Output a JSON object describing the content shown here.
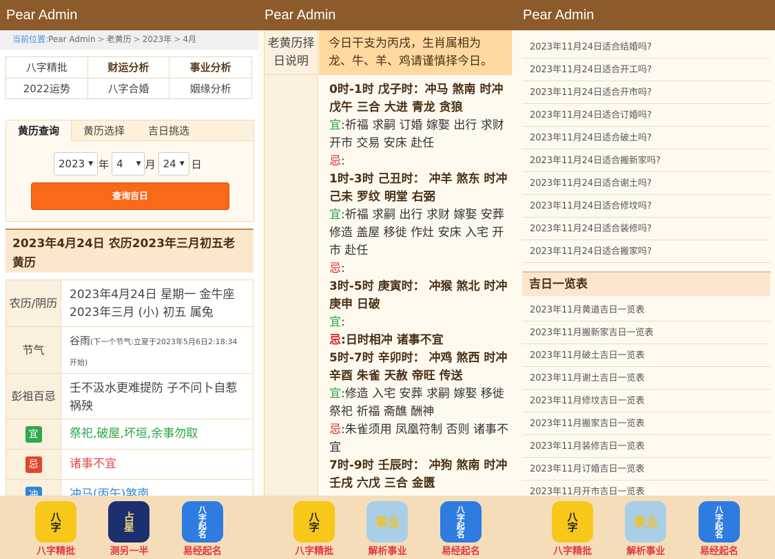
{
  "app_title": "Pear Admin",
  "breadcrumb": [
    "当前位置:",
    "Pear Admin",
    "老黄历",
    "2023年",
    "4月"
  ],
  "nav_grid": [
    "八字精批",
    "财运分析",
    "事业分析",
    "2022运势",
    "八字合婚",
    "姻缘分析"
  ],
  "query": {
    "tabs": [
      "黄历查询",
      "黄历选择",
      "吉日挑选"
    ],
    "year": "2023",
    "year_unit": "年",
    "month": "4",
    "month_unit": "月",
    "day": "24",
    "day_unit": "日",
    "button": "查询吉日"
  },
  "day_title": "2023年4月24日 农历2023年三月初五老黄历",
  "details": {
    "nongli_label": "农历/阴历",
    "nongli_line1": "2023年4月24日 星期一 金牛座",
    "nongli_line2": "2023年三月 (小) 初五 属兔",
    "jieqi_label": "节气",
    "jieqi_value": "谷雨",
    "jieqi_note": "(下一个节气:立夏于2023年5月6日2:18:34开始)",
    "pengzu_label": "彭祖百忌",
    "pengzu_value": "壬不汲水更难提防 子不问卜自惹祸殃",
    "yi_tag": "宜",
    "yi_value": "祭祀,破屋,坏垣,余事勿取",
    "ji_tag": "忌",
    "ji_value": "诸事不宜",
    "chong_tag": "冲",
    "chong_value": "冲马(丙午)煞南"
  },
  "apps_left": [
    {
      "icon": "bazi-icon",
      "label": "八字精批"
    },
    {
      "icon": "star-icon",
      "label": "测另一半"
    },
    {
      "icon": "naming-icon",
      "label": "易经起名"
    }
  ],
  "apps_mid": [
    {
      "icon": "bazi-icon",
      "label": "八字精批"
    },
    {
      "icon": "career-icon",
      "label": "解析事业"
    },
    {
      "icon": "naming-icon",
      "label": "易经起名"
    }
  ],
  "apps_right": [
    {
      "icon": "bazi-icon",
      "label": "八字精批"
    },
    {
      "icon": "career-icon",
      "label": "解析事业"
    },
    {
      "icon": "naming-icon",
      "label": "易经起名"
    }
  ],
  "icon_text": {
    "bazi": "八字",
    "star": "占星",
    "naming": "八字起名",
    "career": "事业"
  },
  "yellow_calendar": {
    "label": "老黄历择日说明",
    "header": "今日干支为丙戌，生肖属相为龙、牛、羊、鸡请谨慎择今日。",
    "hours": [
      {
        "title": "0时-1时 戊子时：冲马 煞南 时冲戊午 三合 大进 青龙 贪狼",
        "yi": "祈福 求嗣 订婚 嫁娶 出行 求财 开市 交易 安床 赴任",
        "ji": ""
      },
      {
        "title": "1时-3时 己丑时： 冲羊 煞东 时冲己未 罗纹 明堂 右弼",
        "yi": "祈福 求嗣 出行 求财 嫁娶 安葬 修造 盖屋 移徙 作灶 安床 入宅 开市 赴任",
        "ji": ""
      },
      {
        "title": "3时-5时 庚寅时： 冲猴 煞北 时冲庚申 日破",
        "yi": "",
        "ji": "日时相冲 诸事不宜"
      },
      {
        "title": "5时-7时 辛卯时： 冲鸡 煞西 时冲辛酉 朱雀 天赦 帝旺 传送",
        "yi": "修造 入宅 安葬 求嗣 嫁娶 移徙 祭祀 祈福 斋醮 酬神",
        "ji": "朱雀须用 凤凰符制 否则 诸事不宜"
      },
      {
        "title": "7时-9时 壬辰时： 冲狗 煞南 时冲壬戌 六戊 三合 金匮",
        "yi": "",
        "ji": ""
      }
    ],
    "yi_label": "宜",
    "ji_label": "忌",
    "colon": ":"
  },
  "questions": [
    "2023年11月24日适合结婚吗?",
    "2023年11月24日适合开工吗?",
    "2023年11月24日适合开市吗?",
    "2023年11月24日适合订婚吗?",
    "2023年11月24日适合破土吗?",
    "2023年11月24日适合搬新家吗?",
    "2023年11月24日适合谢土吗?",
    "2023年11月24日适合修坟吗?",
    "2023年11月24日适合装修吗?",
    "2023年11月24日适合搬家吗?"
  ],
  "jiri_title": "吉日一览表",
  "jiri_list": [
    "2023年11月黄道吉日一览表",
    "2023年11月搬新家吉日一览表",
    "2023年11月破土吉日一览表",
    "2023年11月谢土吉日一览表",
    "2023年11月修坟吉日一览表",
    "2023年11月搬家吉日一览表",
    "2023年11月装修吉日一览表",
    "2023年11月订婚吉日一览表",
    "2023年11月开市吉日一览表"
  ],
  "colors": {
    "topbar": "#8d5a2b",
    "button": "#fa6819",
    "yi": "#28a745",
    "ji": "#e02828"
  }
}
